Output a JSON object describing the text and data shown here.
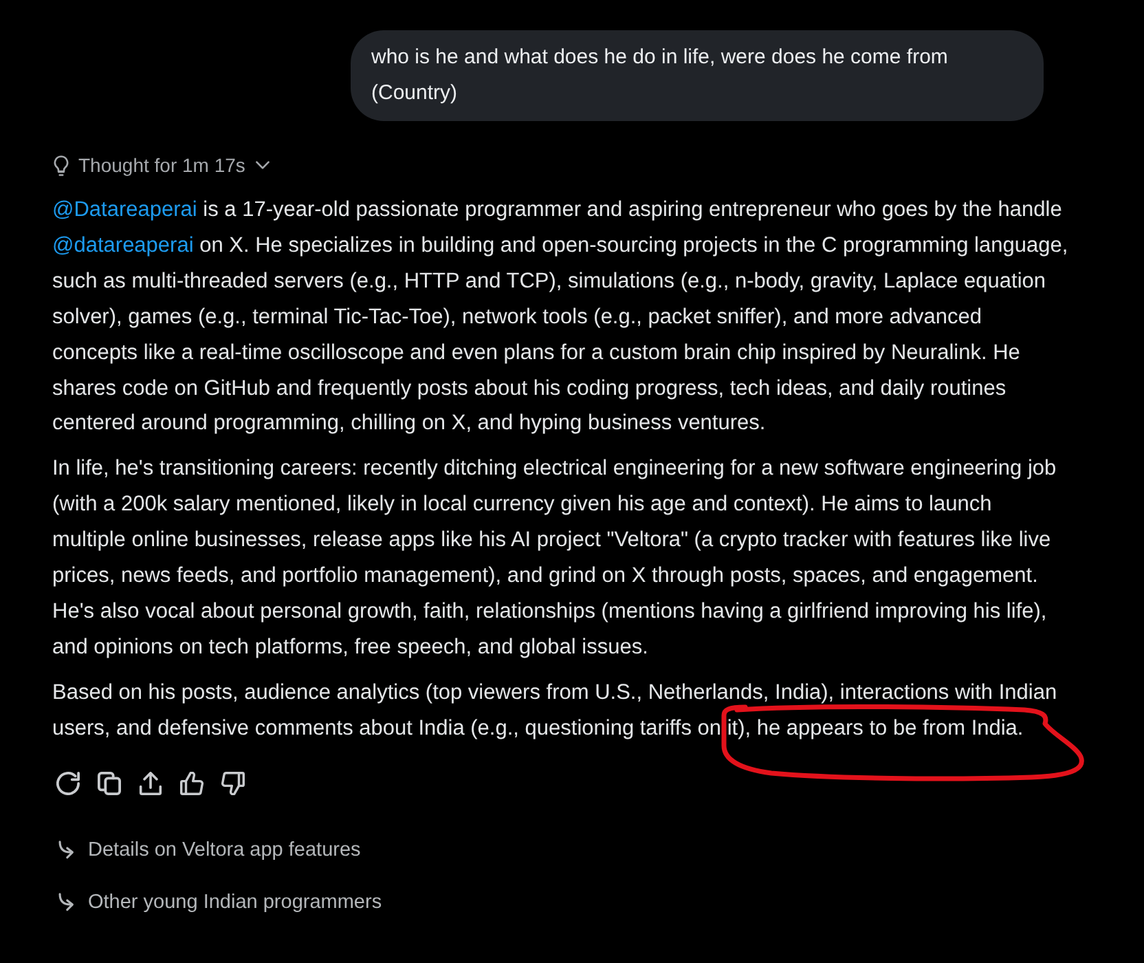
{
  "user_message": {
    "text": "who is he and what does he do in life, were does he come from (Country)"
  },
  "response": {
    "thought": {
      "label": "Thought for 1m 17s",
      "expanded": false
    },
    "paragraphs": [
      {
        "segments": [
          {
            "kind": "mention",
            "text": "@Datareaperai"
          },
          {
            "kind": "text",
            "text": " is a 17-year-old passionate programmer and aspiring entrepreneur who goes by the handle "
          },
          {
            "kind": "mention",
            "text": "@datareaperai"
          },
          {
            "kind": "text",
            "text": " on X. He specializes in building and open-sourcing projects in the C programming language, such as multi-threaded servers (e.g., HTTP and TCP), simulations (e.g., n-body, gravity, Laplace equation solver), games (e.g., terminal Tic-Tac-Toe), network tools (e.g., packet sniffer), and more advanced concepts like a real-time oscilloscope and even plans for a custom brain chip inspired by Neuralink. He shares code on GitHub and frequently posts about his coding progress, tech ideas, and daily routines centered around programming, chilling on X, and hyping business ventures."
          }
        ]
      },
      {
        "segments": [
          {
            "kind": "text",
            "text": "In life, he's transitioning careers: recently ditching electrical engineering for a new software engineering job (with a 200k salary mentioned, likely in local currency given his age and context). He aims to launch multiple online businesses, release apps like his AI project \"Veltora\" (a crypto tracker with features like live prices, news feeds, and portfolio management), and grind on X through posts, spaces, and engagement. He's also vocal about personal growth, faith, relationships (mentions having a girlfriend improving his life), and opinions on tech platforms, free speech, and global issues."
          }
        ]
      },
      {
        "segments": [
          {
            "kind": "text",
            "text": "Based on his posts, audience analytics (top viewers from U.S., Netherlands, India), interactions with Indian users, and defensive comments about India (e.g., questioning tariffs on it), he appears to be from India."
          }
        ]
      }
    ]
  },
  "suggestions": [
    {
      "text": "Details on Veltora app features"
    },
    {
      "text": "Other young Indian programmers"
    }
  ]
}
